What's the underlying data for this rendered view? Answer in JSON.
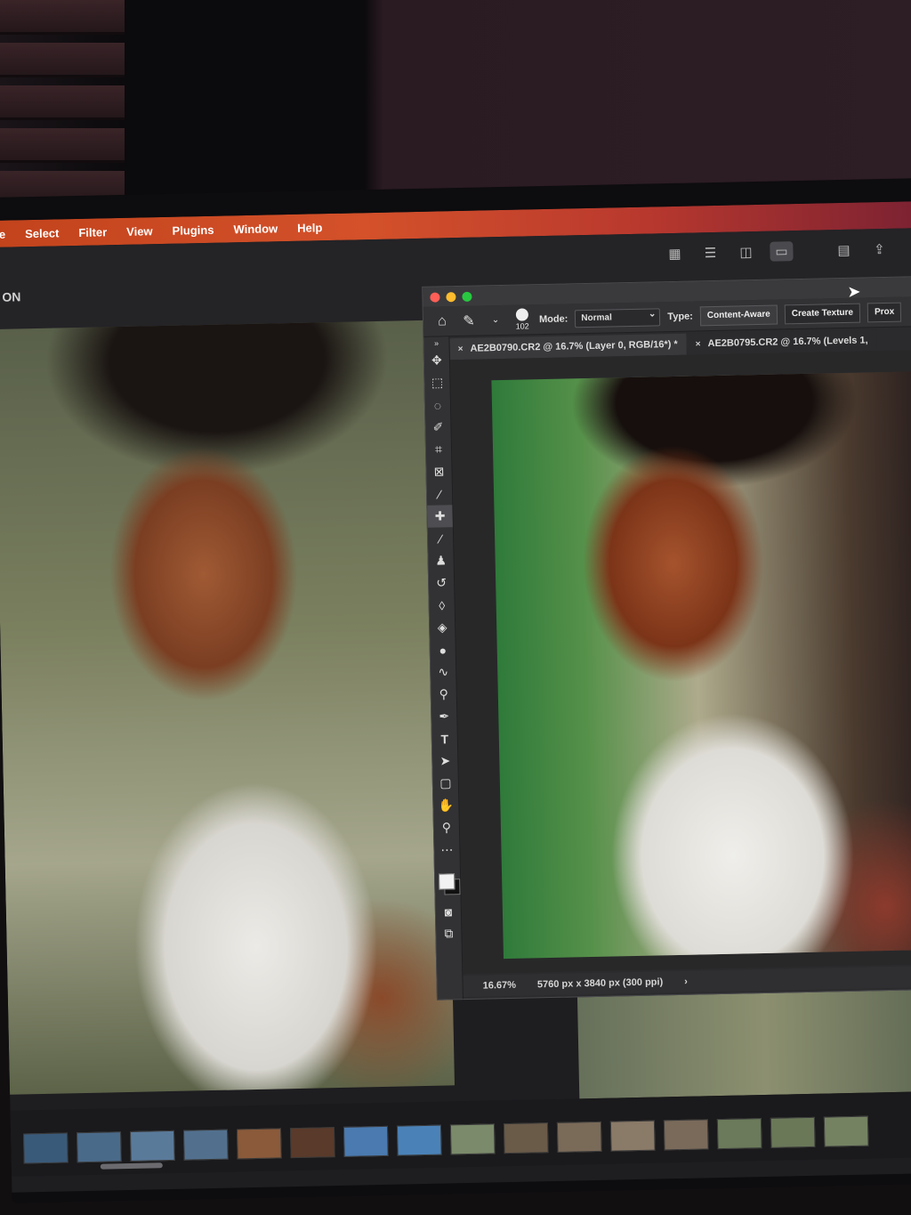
{
  "menu": {
    "items": [
      "e",
      "Select",
      "Filter",
      "View",
      "Plugins",
      "Window",
      "Help"
    ]
  },
  "app_header": {
    "label": "ON",
    "view_icons": [
      "grid-view-icon",
      "list-view-icon",
      "compare-view-icon",
      "loupe-view-icon",
      "panel-layout-icon",
      "share-icon"
    ]
  },
  "photoshop": {
    "options_bar": {
      "brush_size": "102",
      "mode_label": "Mode:",
      "mode_value": "Normal",
      "type_label": "Type:",
      "type_options": [
        "Content-Aware",
        "Create Texture",
        "Prox"
      ]
    },
    "tabs": [
      {
        "title": "AE2B0790.CR2 @ 16.7% (Layer 0, RGB/16*) *",
        "close": "×"
      },
      {
        "title": "AE2B0795.CR2 @ 16.7% (Levels 1,",
        "close": "×"
      }
    ],
    "tools": [
      "move-icon",
      "marquee-icon",
      "lasso-icon",
      "quick-select-icon",
      "crop-icon",
      "frame-icon",
      "eyedropper-icon",
      "spot-healing-icon",
      "brush-icon",
      "clone-stamp-icon",
      "history-brush-icon",
      "eraser-icon",
      "paint-bucket-icon",
      "blur-icon",
      "smudge-icon",
      "dodge-icon",
      "pen-icon",
      "type-icon",
      "path-select-icon",
      "rectangle-icon",
      "hand-icon",
      "zoom-icon",
      "more-tools-icon"
    ],
    "status": {
      "zoom": "16.67%",
      "doc_info": "5760 px x 3840 px (300 ppi)"
    }
  },
  "colors": {
    "menubar_start": "#c2431c",
    "menubar_end": "#7a2132"
  }
}
